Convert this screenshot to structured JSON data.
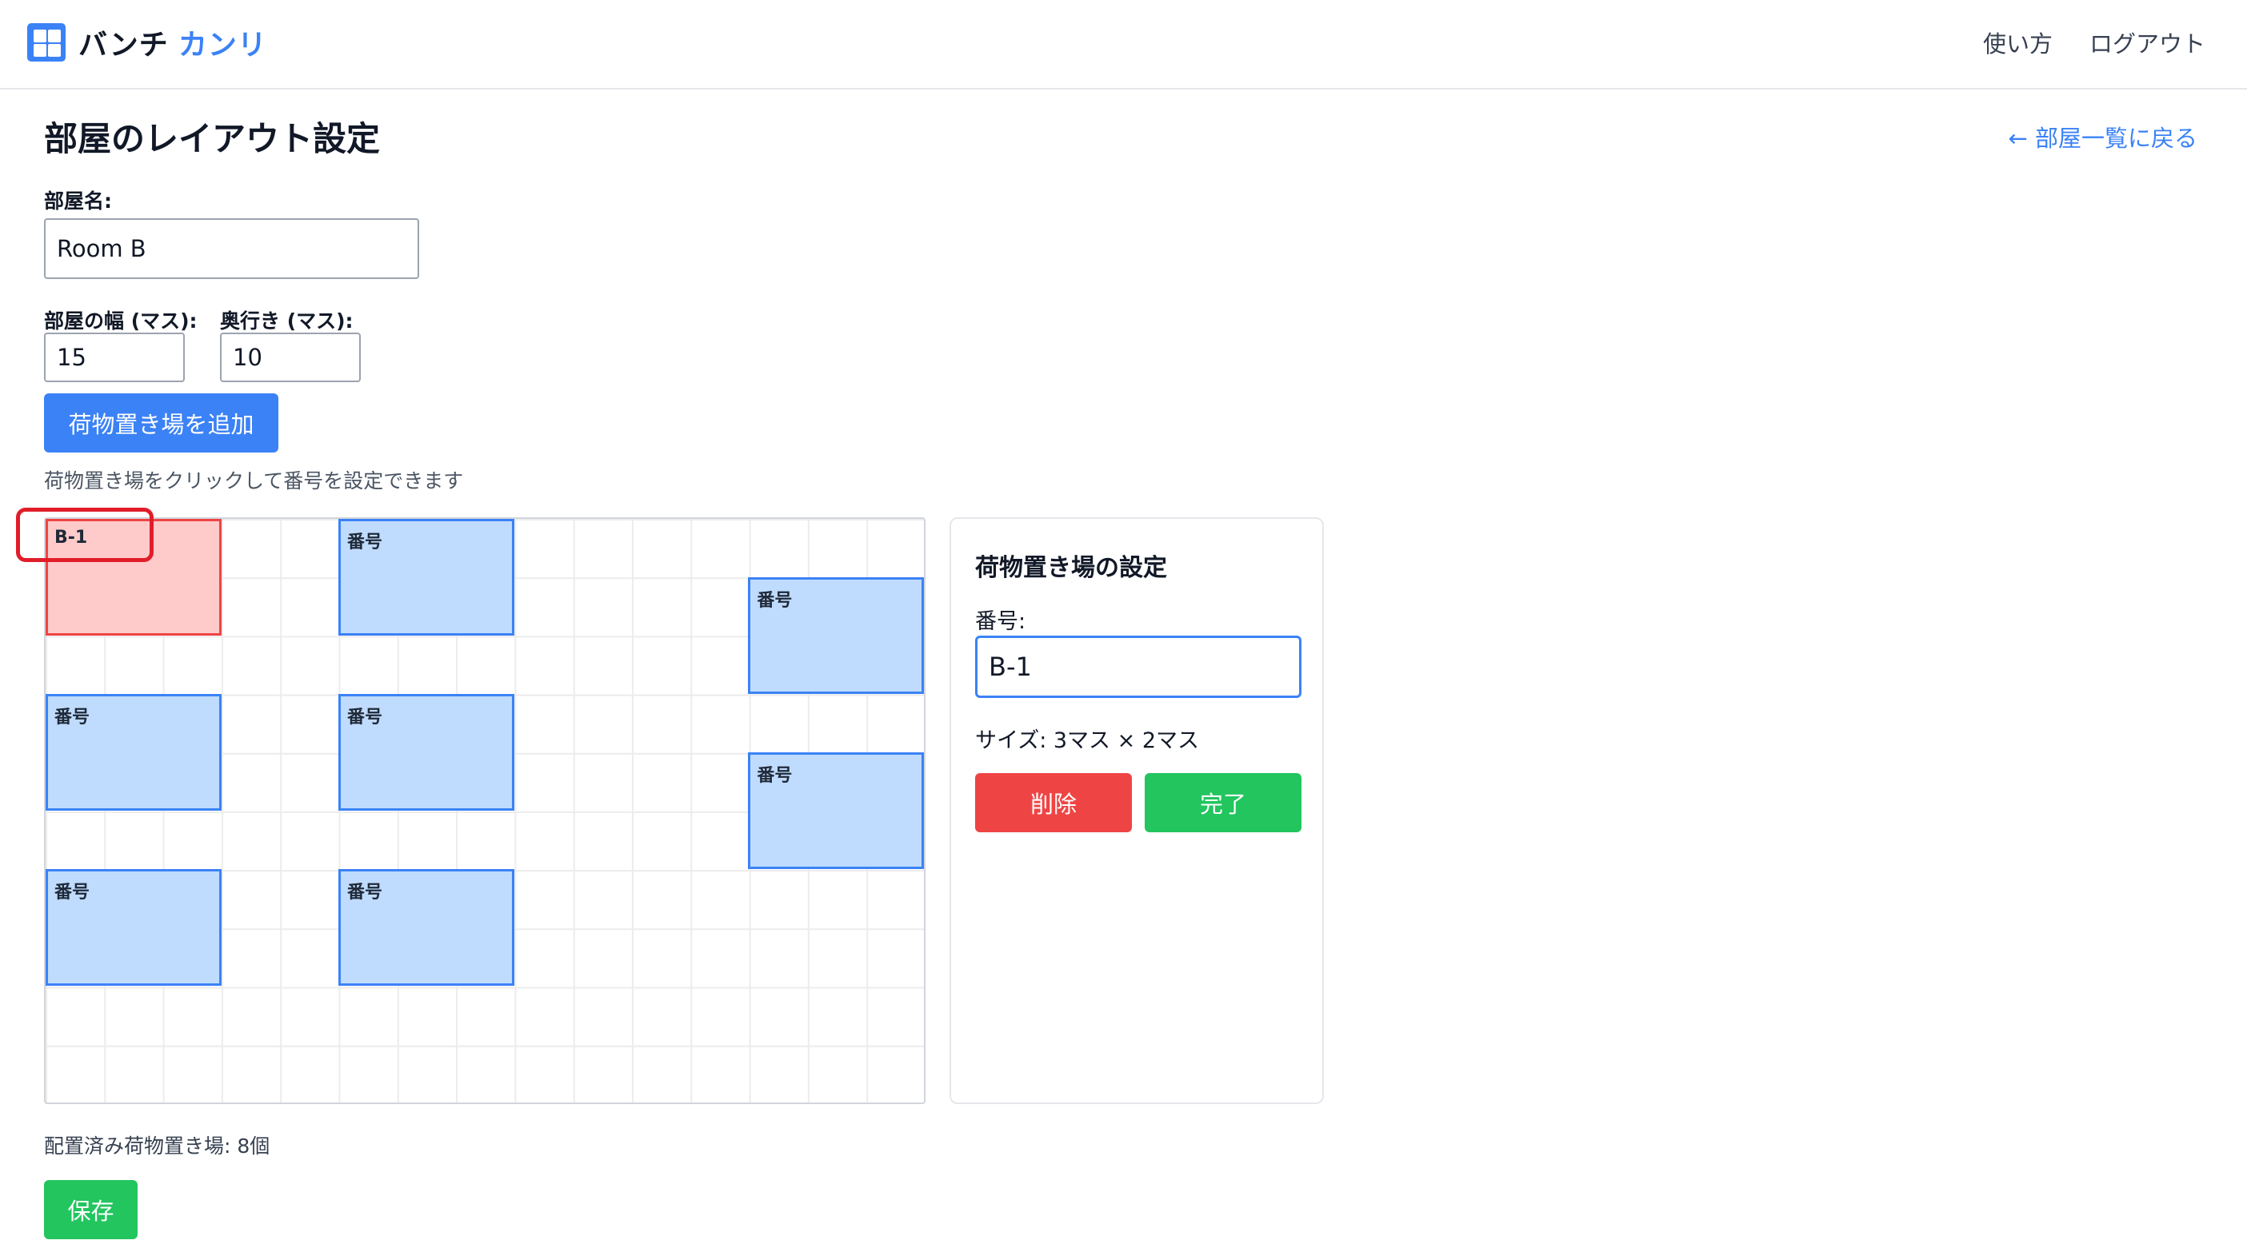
{
  "app": {
    "name_main": "バンチ",
    "name_accent": "カンリ"
  },
  "nav": {
    "help": "使い方",
    "logout": "ログアウト"
  },
  "page": {
    "title": "部屋のレイアウト設定",
    "back_link": "← 部屋一覧に戻る"
  },
  "form": {
    "room_name_label": "部屋名:",
    "room_name_value": "Room B",
    "width_label": "部屋の幅 (マス):",
    "width_value": "15",
    "depth_label": "奥行き (マス):",
    "depth_value": "10",
    "add_spot_button": "荷物置き場を追加",
    "hint": "荷物置き場をクリックして番号を設定できます"
  },
  "grid": {
    "columns": 15,
    "rows": 10,
    "spots": [
      {
        "label": "B-1",
        "col": 0,
        "row": 0,
        "w": 3,
        "h": 2,
        "selected": true
      },
      {
        "label": "番号",
        "col": 5,
        "row": 0,
        "w": 3,
        "h": 2,
        "selected": false
      },
      {
        "label": "番号",
        "col": 12,
        "row": 1,
        "w": 3,
        "h": 2,
        "selected": false
      },
      {
        "label": "番号",
        "col": 0,
        "row": 3,
        "w": 3,
        "h": 2,
        "selected": false
      },
      {
        "label": "番号",
        "col": 5,
        "row": 3,
        "w": 3,
        "h": 2,
        "selected": false
      },
      {
        "label": "番号",
        "col": 12,
        "row": 4,
        "w": 3,
        "h": 2,
        "selected": false
      },
      {
        "label": "番号",
        "col": 0,
        "row": 6,
        "w": 3,
        "h": 2,
        "selected": false
      },
      {
        "label": "番号",
        "col": 5,
        "row": 6,
        "w": 3,
        "h": 2,
        "selected": false
      }
    ]
  },
  "panel": {
    "title": "荷物置き場の設定",
    "number_label": "番号:",
    "number_value": "B-1",
    "size_text": "サイズ: 3マス × 2マス",
    "delete_button": "削除",
    "done_button": "完了"
  },
  "footer": {
    "placed_count": "配置済み荷物置き場: 8個",
    "save_button": "保存"
  },
  "colors": {
    "accent": "#3b82f6",
    "danger": "#ef4444",
    "success": "#22c55e",
    "spot_fill": "#bfdbfe",
    "selected_fill": "#fecaca",
    "highlight": "#e11d2a"
  }
}
